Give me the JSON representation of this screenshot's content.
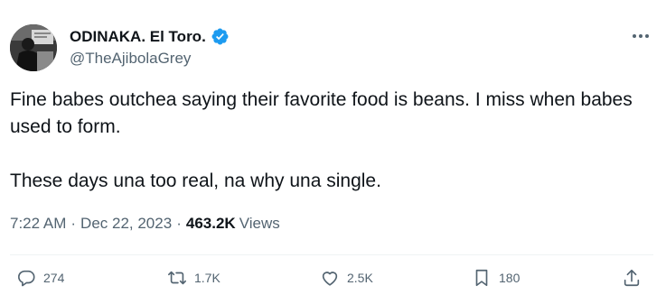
{
  "user": {
    "display_name": "ODINAKA. El Toro.",
    "handle": "@TheAjibolaGrey",
    "verified": true
  },
  "icons": {
    "verified": "verified-badge-icon",
    "more": "more-horizontal-icon",
    "reply": "reply-icon",
    "retweet": "retweet-icon",
    "like": "heart-icon",
    "bookmark": "bookmark-icon",
    "share": "share-icon"
  },
  "colors": {
    "verified_blue": "#1d9bf0",
    "secondary_text": "#536471",
    "primary_text": "#0f1419"
  },
  "tweet": {
    "paragraphs": [
      "Fine babes outchea saying their favorite food is beans. I miss when babes used to form.",
      "These days una too real, na why una single."
    ],
    "time": "7:22 AM",
    "separator": "·",
    "date": "Dec 22, 2023",
    "views_count": "463.2K",
    "views_label": "Views"
  },
  "actions": {
    "replies": "274",
    "retweets": "1.7K",
    "likes": "2.5K",
    "bookmarks": "180"
  }
}
